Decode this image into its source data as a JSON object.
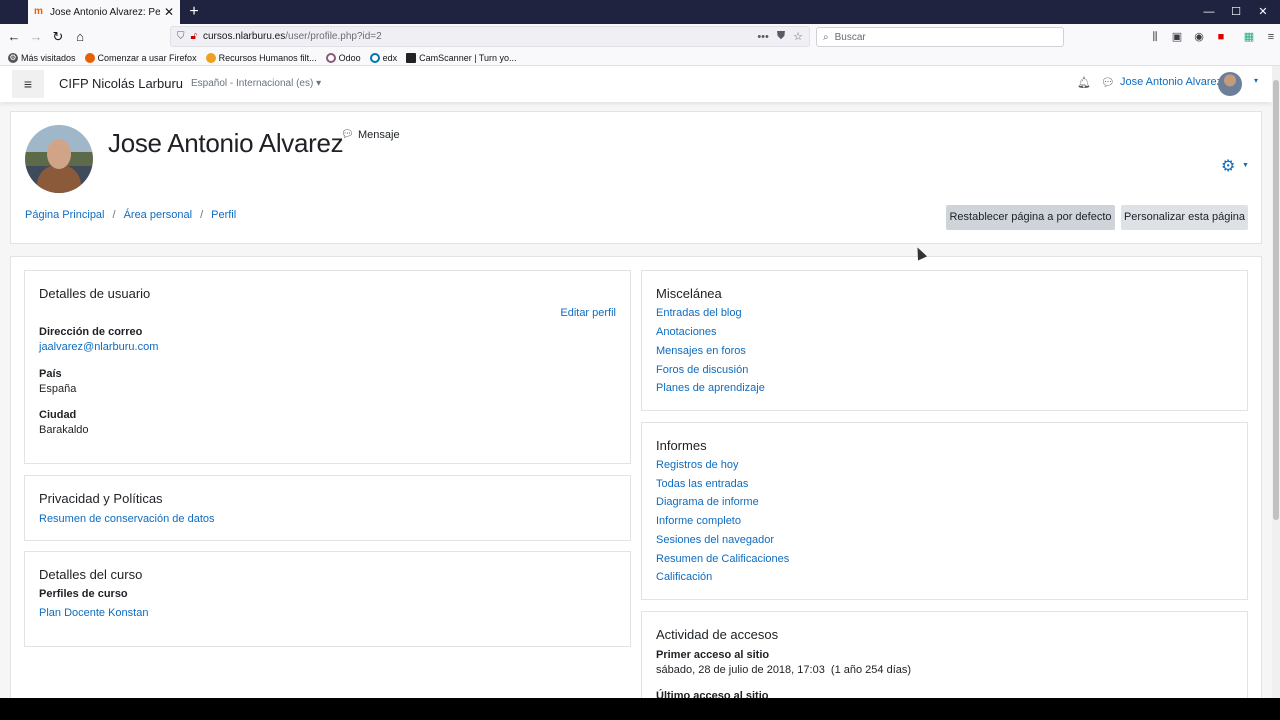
{
  "browser": {
    "tab_title": "Jose Antonio Alvarez: Perfil pú",
    "tab_close": "✕",
    "new_tab": "+",
    "url_host": "cursos.nlarburu.es",
    "url_path": "/user/profile.php?id=2",
    "search_placeholder": "Buscar",
    "bookmarks": [
      {
        "label": "Más visitados",
        "color": "#555555",
        "glyph": "⚙"
      },
      {
        "label": "Comenzar a usar Firefox",
        "color": "#e66000",
        "glyph": ""
      },
      {
        "label": "Recursos Humanos filt...",
        "color": "#f0a020",
        "glyph": ""
      },
      {
        "label": "Odoo",
        "color": "#875a7b",
        "glyph": ""
      },
      {
        "label": "edx",
        "color": "#0075b4",
        "glyph": ""
      },
      {
        "label": "CamScanner | Turn yo...",
        "color": "#222222",
        "glyph": ""
      }
    ]
  },
  "nav": {
    "menu_glyph": "≡",
    "site_name": "CIFP Nicolás Larburu",
    "language": "Español - Internacional (es) ▾",
    "user_name": "Jose Antonio Alvarez"
  },
  "header": {
    "full_name": "Jose Antonio Alvarez",
    "message_label": "Mensaje",
    "breadcrumb": [
      "Página Principal",
      "Área personal",
      "Perfil"
    ],
    "reset_button": "Restablecer página a por defecto",
    "customize_button": "Personalizar esta página"
  },
  "user_details": {
    "title": "Detalles de usuario",
    "edit_profile": "Editar perfil",
    "email_label": "Dirección de correo",
    "email_value": "jaalvarez@nlarburu.com",
    "country_label": "País",
    "country_value": "España",
    "city_label": "Ciudad",
    "city_value": "Barakaldo"
  },
  "privacy": {
    "title": "Privacidad y Políticas",
    "link": "Resumen de conservación de datos"
  },
  "course_details": {
    "title": "Detalles del curso",
    "label": "Perfiles de curso",
    "link": "Plan Docente Konstan"
  },
  "misc": {
    "title": "Miscelánea",
    "links": [
      "Entradas del blog",
      "Anotaciones",
      "Mensajes en foros",
      "Foros de discusión",
      "Planes de aprendizaje"
    ]
  },
  "reports": {
    "title": "Informes",
    "links": [
      "Registros de hoy",
      "Todas las entradas",
      "Diagrama de informe",
      "Informe completo",
      "Sesiones del navegador",
      "Resumen de Calificaciones",
      "Calificación"
    ]
  },
  "access": {
    "title": "Actividad de accesos",
    "first_label": "Primer acceso al sitio",
    "first_value": "sábado, 28 de julio de 2018, 17:03  (1 año 254 días)",
    "last_label": "Último acceso al sitio"
  }
}
